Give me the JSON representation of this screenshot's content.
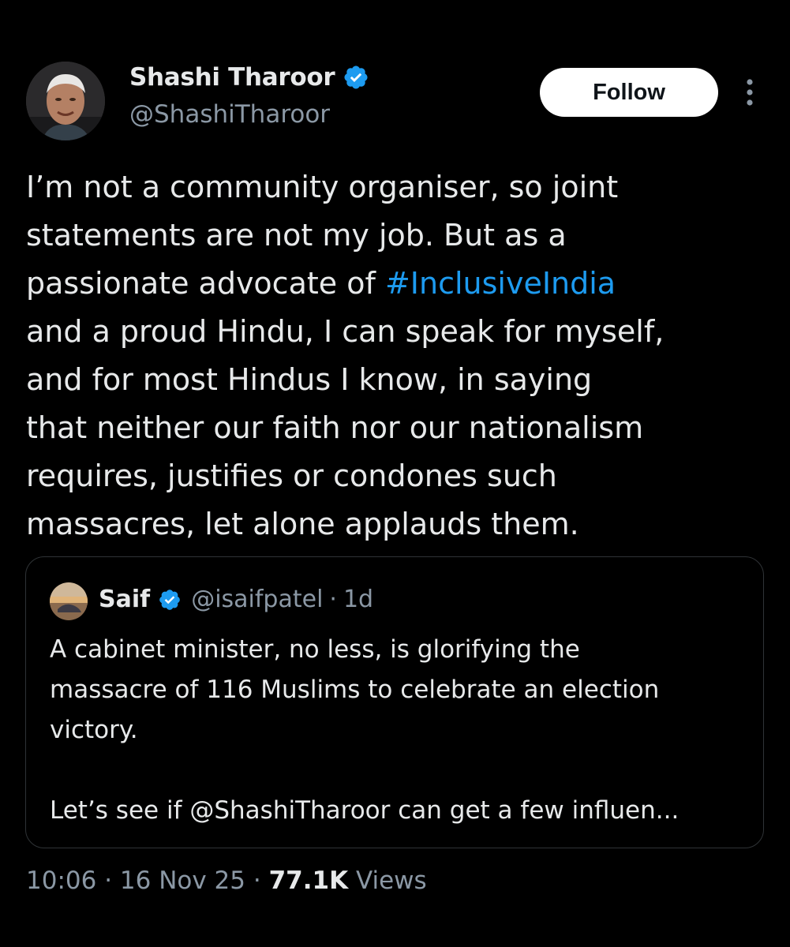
{
  "author": {
    "name": "Shashi Tharoor",
    "handle": "@ShashiTharoor",
    "verified_icon": "verified-badge-icon",
    "badge_color": "#1d9bf0"
  },
  "actions": {
    "follow_label": "Follow",
    "more_icon": "more-vertical-icon"
  },
  "tweet": {
    "lines": [
      "I’m not a community organiser, so joint",
      "statements are not my job. But as a",
      "passionate advocate of ",
      "and a proud Hindu, I can speak for myself,",
      "and for most Hindus I know, in saying",
      "that neither our faith nor our nationalism",
      "requires, justifies or condones such",
      "massacres, let alone applauds them."
    ],
    "hashtag": "#InclusiveIndia",
    "hashtag_color": "#1d9bf0"
  },
  "quoted": {
    "name": "Saif",
    "handle": "@isaifpatel",
    "separator": "·",
    "time": "1d",
    "lines": [
      "A cabinet minister, no less, is glorifying the",
      "massacre of 116 Muslims to celebrate an election",
      "victory.",
      "Let’s see if @ShashiTharoor can get a few influen..."
    ]
  },
  "meta": {
    "time": "10:06",
    "sep1": " · ",
    "date": "16 Nov 25",
    "sep2": " · ",
    "views_count": "77.1K",
    "views_label": " Views"
  },
  "colors": {
    "background": "#000000",
    "text": "#e7e9ea",
    "secondary": "#8b98a5",
    "accent": "#1d9bf0",
    "border": "#2f3336"
  }
}
